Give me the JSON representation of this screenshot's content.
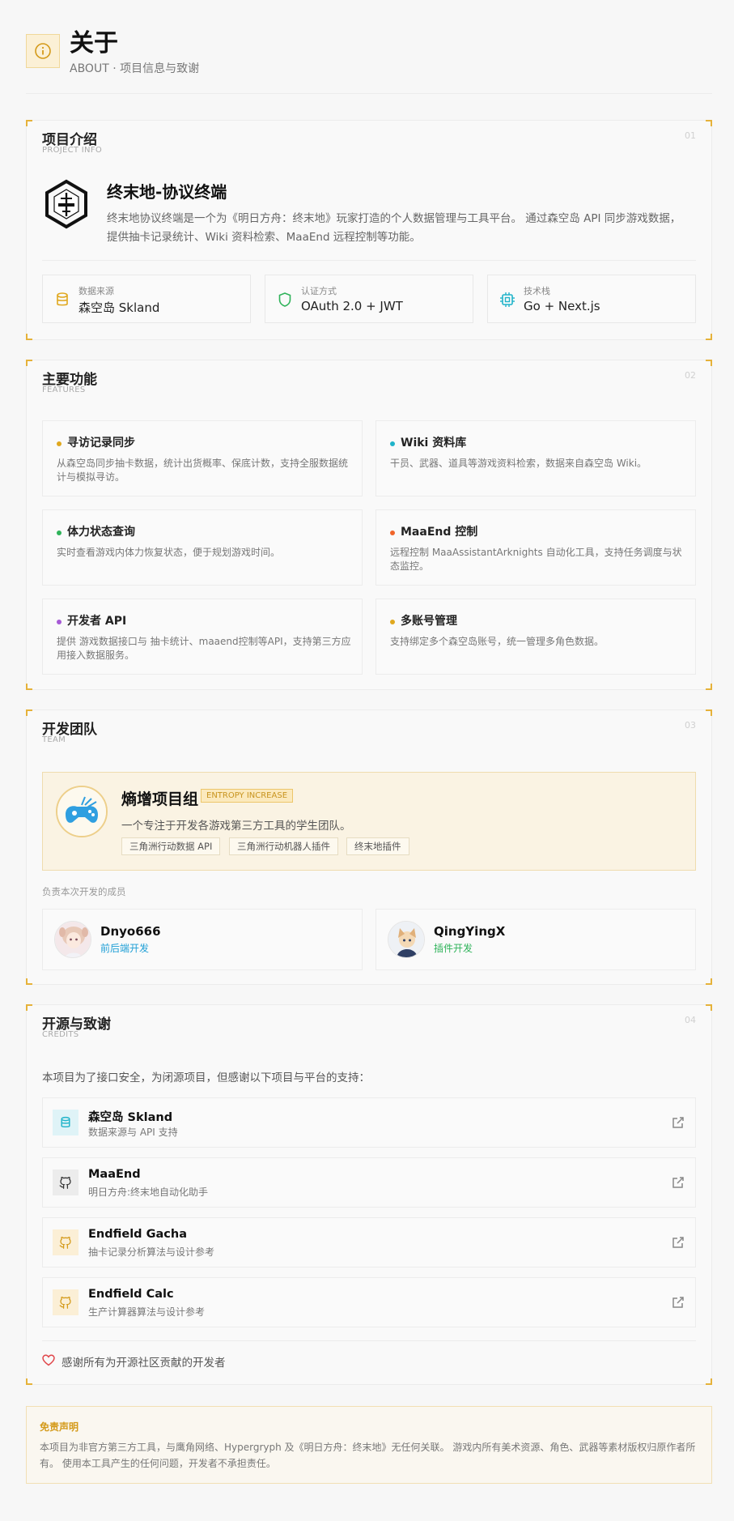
{
  "header": {
    "title": "关于",
    "subtitle": "ABOUT · 项目信息与致谢",
    "icon": "info-icon"
  },
  "project": {
    "title": "项目介绍",
    "title_en": "PROJECT INFO",
    "number": "01",
    "name": "终末地-协议终端",
    "description": "终末地协议终端是一个为《明日方舟：终末地》玩家打造的个人数据管理与工具平台。 通过森空岛 API 同步游戏数据，提供抽卡记录统计、Wiki 资料检索、MaaEnd 远程控制等功能。",
    "cards": [
      {
        "label": "数据来源",
        "value": "森空岛 Skland",
        "icon": "database-icon",
        "color": "#e0a81e"
      },
      {
        "label": "认证方式",
        "value": "OAuth 2.0 + JWT",
        "icon": "shield-icon",
        "color": "#2fb35a"
      },
      {
        "label": "技术栈",
        "value": "Go + Next.js",
        "icon": "chip-icon",
        "color": "#1fb3c9"
      }
    ]
  },
  "features": {
    "title": "主要功能",
    "title_en": "FEATURES",
    "number": "02",
    "items": [
      {
        "title": "寻访记录同步",
        "desc": "从森空岛同步抽卡数据，统计出货概率、保底计数，支持全服数据统计与模拟寻访。",
        "color": "#e0a81e"
      },
      {
        "title": "Wiki 资料库",
        "desc": "干员、武器、道具等游戏资料检索，数据来自森空岛 Wiki。",
        "color": "#1fb3c9"
      },
      {
        "title": "体力状态查询",
        "desc": "实时查看游戏内体力恢复状态，便于规划游戏时间。",
        "color": "#2fb35a"
      },
      {
        "title": "MaaEnd 控制",
        "desc": "远程控制 MaaAssistantArknights 自动化工具，支持任务调度与状态监控。",
        "color": "#f0652a"
      },
      {
        "title": "开发者 API",
        "desc": "提供 游戏数据接口与 抽卡统计、maaend控制等API，支持第三方应用接入数据服务。",
        "color": "#a65ad6"
      },
      {
        "title": "多账号管理",
        "desc": "支持绑定多个森空岛账号，统一管理多角色数据。",
        "color": "#e0a81e"
      }
    ]
  },
  "team": {
    "title": "开发团队",
    "title_en": "TEAM",
    "number": "03",
    "group_name": "熵增项目组",
    "group_tag": "ENTROPY INCREASE",
    "group_desc": "一个专注于开发各游戏第三方工具的学生团队。",
    "chips": [
      "三角洲行动数据 API",
      "三角洲行动机器人插件",
      "终末地插件"
    ],
    "members_label": "负责本次开发的成员",
    "members": [
      {
        "name": "Dnyo666",
        "role": "前后端开发",
        "role_color": "#1f9fd6"
      },
      {
        "name": "QingYingX",
        "role": "插件开发",
        "role_color": "#2fb35a"
      }
    ]
  },
  "credits": {
    "title": "开源与致谢",
    "title_en": "CREDITS",
    "number": "04",
    "intro": "本项目为了接口安全，为闭源项目，但感谢以下项目与平台的支持：",
    "items": [
      {
        "name": "森空岛 Skland",
        "desc": "数据来源与 API 支持",
        "icon": "database-icon",
        "bg": "#dff3f7",
        "color": "#1fb3c9"
      },
      {
        "name": "MaaEnd",
        "desc": "明日方舟:终末地自动化助手",
        "icon": "github-icon",
        "bg": "#ececec",
        "color": "#333333"
      },
      {
        "name": "Endfield Gacha",
        "desc": "抽卡记录分析算法与设计参考",
        "icon": "github-icon",
        "bg": "#fbefd6",
        "color": "#d49a1a"
      },
      {
        "name": "Endfield Calc",
        "desc": "生产计算器算法与设计参考",
        "icon": "github-icon",
        "bg": "#fbefd6",
        "color": "#d49a1a"
      }
    ],
    "thanks": "感谢所有为开源社区贡献的开发者"
  },
  "disclaimer": {
    "title": "免责声明",
    "text": "本项目为非官方第三方工具，与鹰角网络、Hypergryph 及《明日方舟：终末地》无任何关联。 游戏内所有美术资源、角色、武器等素材版权归原作者所有。 使用本工具产生的任何问题，开发者不承担责任。"
  }
}
